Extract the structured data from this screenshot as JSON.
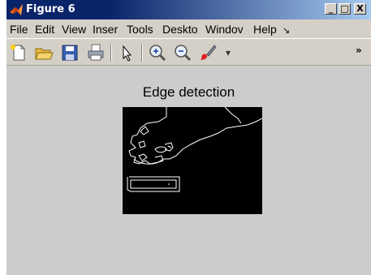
{
  "window": {
    "title": "Figure 6",
    "controls": {
      "minimize": "_",
      "maximize": "□",
      "close": "X"
    }
  },
  "menubar": {
    "items": [
      "File",
      "Edit",
      "View",
      "Insert",
      "Tools",
      "Desktop",
      "Window",
      "Help"
    ],
    "visible_labels": [
      "File",
      "Edit",
      "View",
      "Inser",
      "Tools",
      "Deskto",
      "Windov",
      "Help"
    ]
  },
  "toolbar": {
    "tools": [
      "new-figure-icon",
      "open-file-icon",
      "save-icon",
      "print-icon",
      "pointer-icon",
      "zoom-in-icon",
      "zoom-out-icon",
      "brush-icon",
      "dropdown-arrow-icon",
      "overflow-chevron-icon"
    ]
  },
  "figure": {
    "axes_title": "Edge detection",
    "background": "#cccccc",
    "image_background": "#000000",
    "edge_color": "#ffffff"
  },
  "colors": {
    "titlebar_start": "#0a246a",
    "titlebar_end": "#a6caf0",
    "window_face": "#d4d0c8"
  }
}
